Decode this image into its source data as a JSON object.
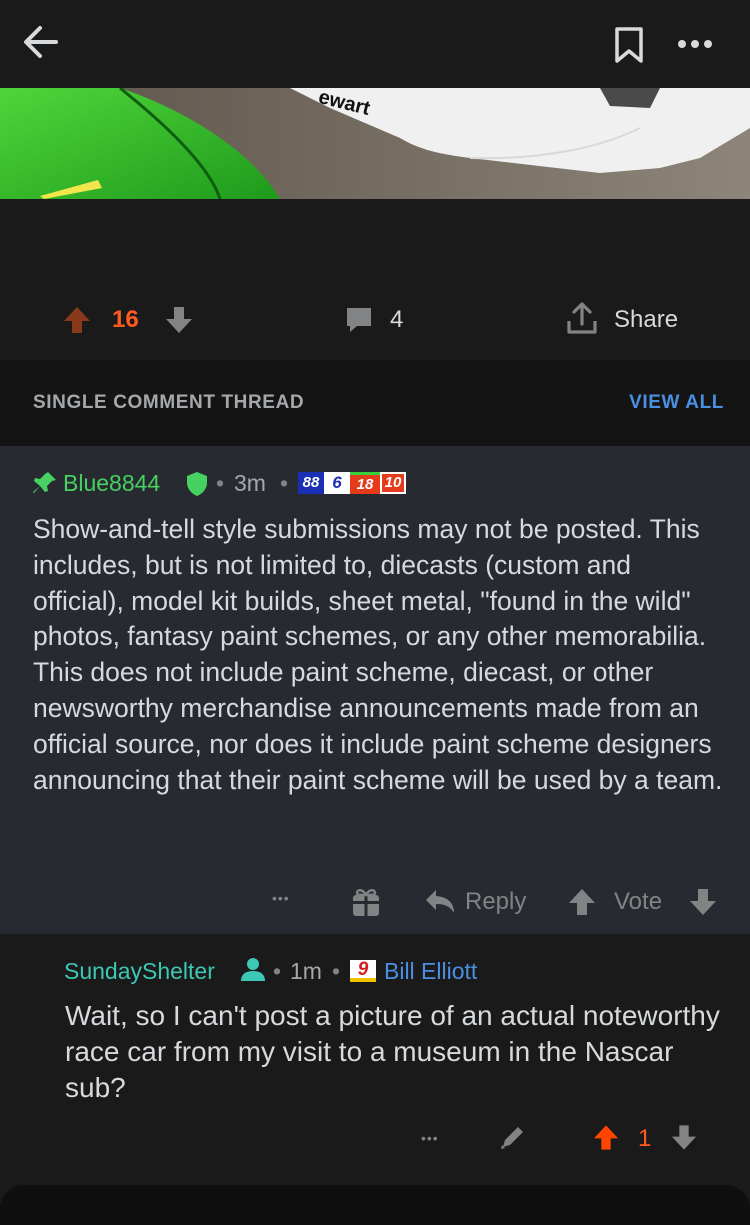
{
  "post": {
    "score": "16",
    "comments": "4",
    "share_label": "Share",
    "photo_text": "ewart"
  },
  "section": {
    "title": "SINGLE COMMENT THREAD",
    "view_all": "VIEW ALL"
  },
  "comment1": {
    "author": "Blue8844",
    "time": "3m",
    "flair_numbers": [
      "88",
      "6",
      "18",
      "10"
    ],
    "body": "Show-and-tell style submissions may not be posted. This includes, but is not limited to, diecasts (custom and official), model kit builds, sheet metal, \"found in the wild\" photos, fantasy paint schemes, or any other memorabilia. This does not include paint scheme, diecast, or other newsworthy merchandise announcements made from an official source, nor does it include paint scheme designers announcing that their paint scheme will be used by a team.",
    "dots": "•••",
    "reply_label": "Reply",
    "vote_label": "Vote"
  },
  "comment2": {
    "author": "SundayShelter",
    "time": "1m",
    "flair_number": "9",
    "flair_text": "Bill Elliott",
    "body": "Wait, so I can't post a picture of an actual noteworthy race car from my visit to a museum in the Nascar sub?",
    "dots": "•••",
    "score": "1"
  },
  "sep": "•",
  "colors": {
    "upvote_orange": "#ff4500",
    "score_orange": "#ff5a1f",
    "mod_green": "#46d160",
    "link_blue": "#4a90e2",
    "author_teal": "#3cc8b4"
  },
  "icons": [
    "back-arrow-icon",
    "bookmark-icon",
    "more-icon",
    "upvote-icon",
    "downvote-icon",
    "comment-icon",
    "share-icon",
    "pin-icon",
    "shield-icon",
    "gift-icon",
    "reply-icon",
    "edit-icon",
    "user-icon"
  ]
}
